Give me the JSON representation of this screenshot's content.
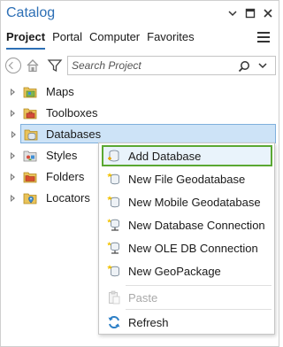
{
  "pane": {
    "title": "Catalog",
    "tabs": [
      "Project",
      "Portal",
      "Computer",
      "Favorites"
    ],
    "active_tab": "Project"
  },
  "toolbar": {
    "search_placeholder": "Search Project",
    "search_value": ""
  },
  "tree": {
    "items": [
      {
        "label": "Maps",
        "icon": "maps-folder-icon"
      },
      {
        "label": "Toolboxes",
        "icon": "toolboxes-folder-icon"
      },
      {
        "label": "Databases",
        "icon": "databases-folder-icon",
        "selected": true
      },
      {
        "label": "Styles",
        "icon": "styles-folder-icon"
      },
      {
        "label": "Folders",
        "icon": "folders-folder-icon"
      },
      {
        "label": "Locators",
        "icon": "locators-folder-icon"
      }
    ]
  },
  "context_menu": {
    "items": [
      {
        "label": "Add Database",
        "icon": "add-database-icon",
        "highlighted": true
      },
      {
        "label": "New File Geodatabase",
        "icon": "new-file-geodatabase-icon"
      },
      {
        "label": "New Mobile Geodatabase",
        "icon": "new-mobile-geodatabase-icon"
      },
      {
        "label": "New Database Connection",
        "icon": "new-database-connection-icon"
      },
      {
        "label": "New OLE DB Connection",
        "icon": "new-ole-db-connection-icon"
      },
      {
        "label": "New GeoPackage",
        "icon": "new-geopackage-icon"
      },
      {
        "label": "Paste",
        "icon": "paste-icon",
        "disabled": true
      },
      {
        "label": "Refresh",
        "icon": "refresh-icon"
      }
    ]
  },
  "colors": {
    "title": "#2d6fb5",
    "selection_fill": "#cde3f7",
    "highlight_border": "#5aa832"
  }
}
